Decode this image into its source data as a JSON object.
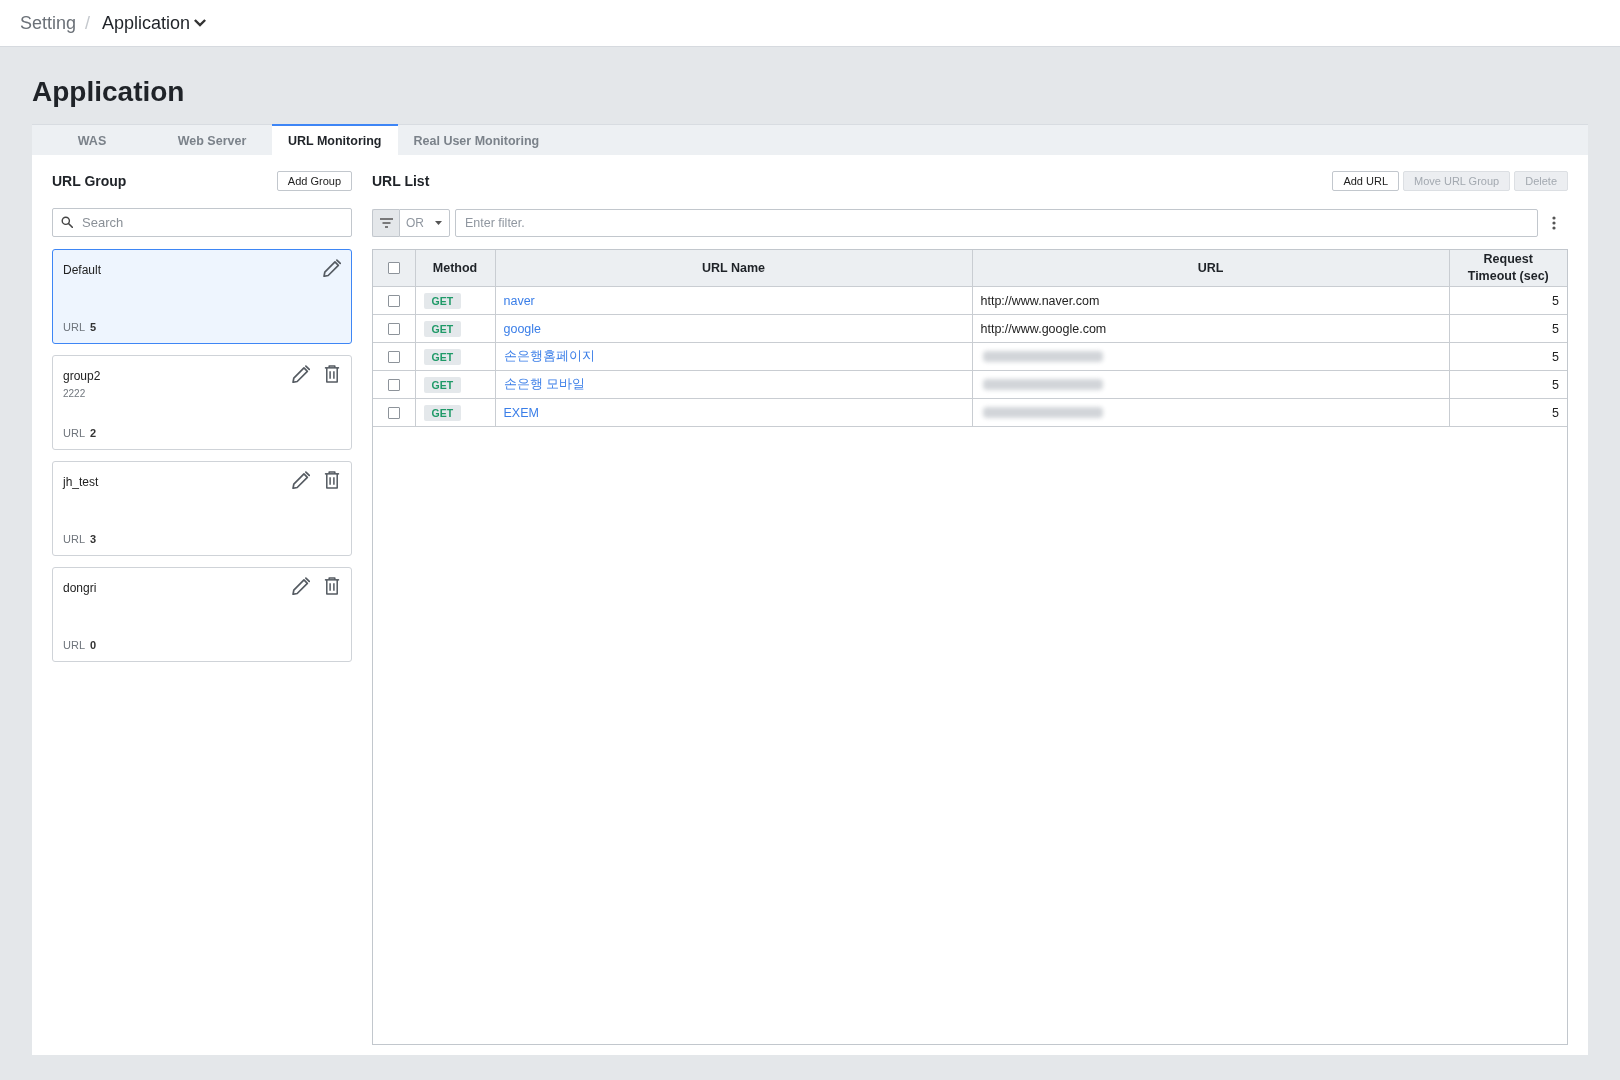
{
  "breadcrumb": {
    "parent": "Setting",
    "separator": "/",
    "current": "Application"
  },
  "page_title": "Application",
  "tabs": [
    {
      "label": "WAS",
      "selected": false
    },
    {
      "label": "Web Server",
      "selected": false
    },
    {
      "label": "URL Monitoring",
      "selected": true
    },
    {
      "label": "Real User Monitoring",
      "selected": false
    }
  ],
  "url_group": {
    "title": "URL Group",
    "add_button": "Add Group",
    "search": {
      "placeholder": "Search"
    },
    "groups": [
      {
        "name": "Default",
        "url_label": "URL",
        "url_count": "5",
        "selected": true,
        "deletable": false
      },
      {
        "name": "group2",
        "description": "2222",
        "url_label": "URL",
        "url_count": "2",
        "selected": false,
        "deletable": true
      },
      {
        "name": "jh_test",
        "url_label": "URL",
        "url_count": "3",
        "selected": false,
        "deletable": true
      },
      {
        "name": "dongri",
        "url_label": "URL",
        "url_count": "0",
        "selected": false,
        "deletable": true
      }
    ]
  },
  "url_list": {
    "title": "URL List",
    "buttons": [
      {
        "label": "Add URL",
        "disabled": false
      },
      {
        "label": "Move URL Group",
        "disabled": true
      },
      {
        "label": "Delete",
        "disabled": true
      }
    ],
    "filter": {
      "operator": "OR",
      "placeholder": "Enter filter."
    },
    "table": {
      "header_checked": false,
      "columns": [
        "Method",
        "URL Name",
        "URL",
        "Request Timeout (sec)"
      ],
      "rows": [
        {
          "checked": false,
          "method": "GET",
          "name": "naver",
          "url": "http://www.naver.com",
          "url_redacted": false,
          "timeout": "5"
        },
        {
          "checked": false,
          "method": "GET",
          "name": "google",
          "url": "http://www.google.com",
          "url_redacted": false,
          "timeout": "5"
        },
        {
          "checked": false,
          "method": "GET",
          "name": "손은행홈페이지",
          "url_redacted": true,
          "timeout": "5"
        },
        {
          "checked": false,
          "method": "GET",
          "name": "손은행 모바일",
          "url_redacted": true,
          "timeout": "5"
        },
        {
          "checked": false,
          "method": "GET",
          "name": "EXEM",
          "url_redacted": true,
          "timeout": "5"
        }
      ]
    }
  }
}
